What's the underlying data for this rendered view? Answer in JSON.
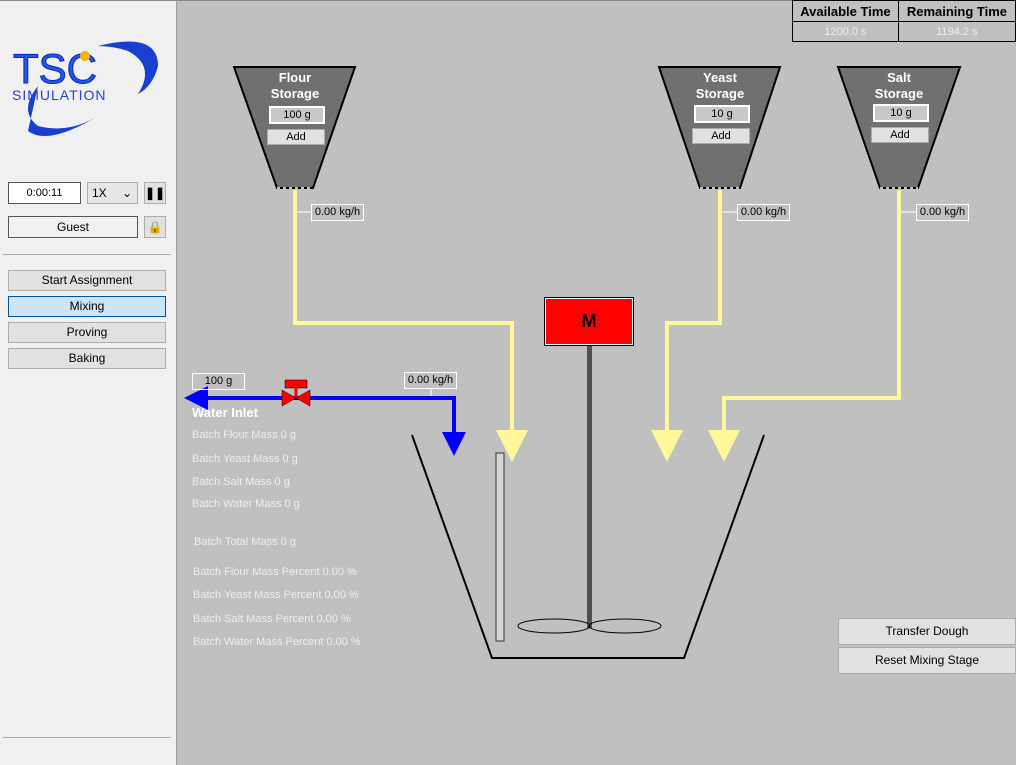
{
  "sidebar": {
    "logo": {
      "text": "TSC",
      "sub": "SIMULATION"
    },
    "clock": "0:00:11",
    "speed": "1X",
    "user": "Guest",
    "nav": [
      {
        "label": "Start Assignment"
      },
      {
        "label": "Mixing",
        "active": true
      },
      {
        "label": "Proving"
      },
      {
        "label": "Baking"
      }
    ]
  },
  "timer": {
    "available_label": "Available Time",
    "remaining_label": "Remaining Time",
    "available": "1200.0 s",
    "remaining": "1194.2 s"
  },
  "hoppers": [
    {
      "title1": "Flour",
      "title2": "Storage",
      "amount": "100 g",
      "add": "Add",
      "flow": "0.00 kg/h"
    },
    {
      "title1": "Yeast",
      "title2": "Storage",
      "amount": "10 g",
      "add": "Add",
      "flow": "0.00 kg/h"
    },
    {
      "title1": "Salt",
      "title2": "Storage",
      "amount": "10 g",
      "add": "Add",
      "flow": "0.00 kg/h"
    }
  ],
  "water": {
    "title": "Water Inlet",
    "amount": "100 g",
    "flow": "0.00 kg/h"
  },
  "mixer": {
    "label": "M"
  },
  "stats": [
    "Batch Flour Mass 0 g",
    "Batch Yeast Mass 0 g",
    "Batch Salt Mass 0 g",
    "Batch Water Mass 0 g",
    "Batch Total Mass 0 g",
    "Batch Flour Mass Percent 0.00 %",
    "Batch Yeast Mass Percent 0.00 %",
    "Batch Salt Mass Percent 0.00 %",
    "Batch Water Mass Percent 0.00 %"
  ],
  "actions": {
    "transfer": "Transfer Dough",
    "reset": "Reset Mixing Stage"
  },
  "colors": {
    "ingredient_pipe": "#fff799",
    "water_pipe": "#0000ff",
    "mixer": "#ff0000",
    "hopper": "#707070"
  }
}
